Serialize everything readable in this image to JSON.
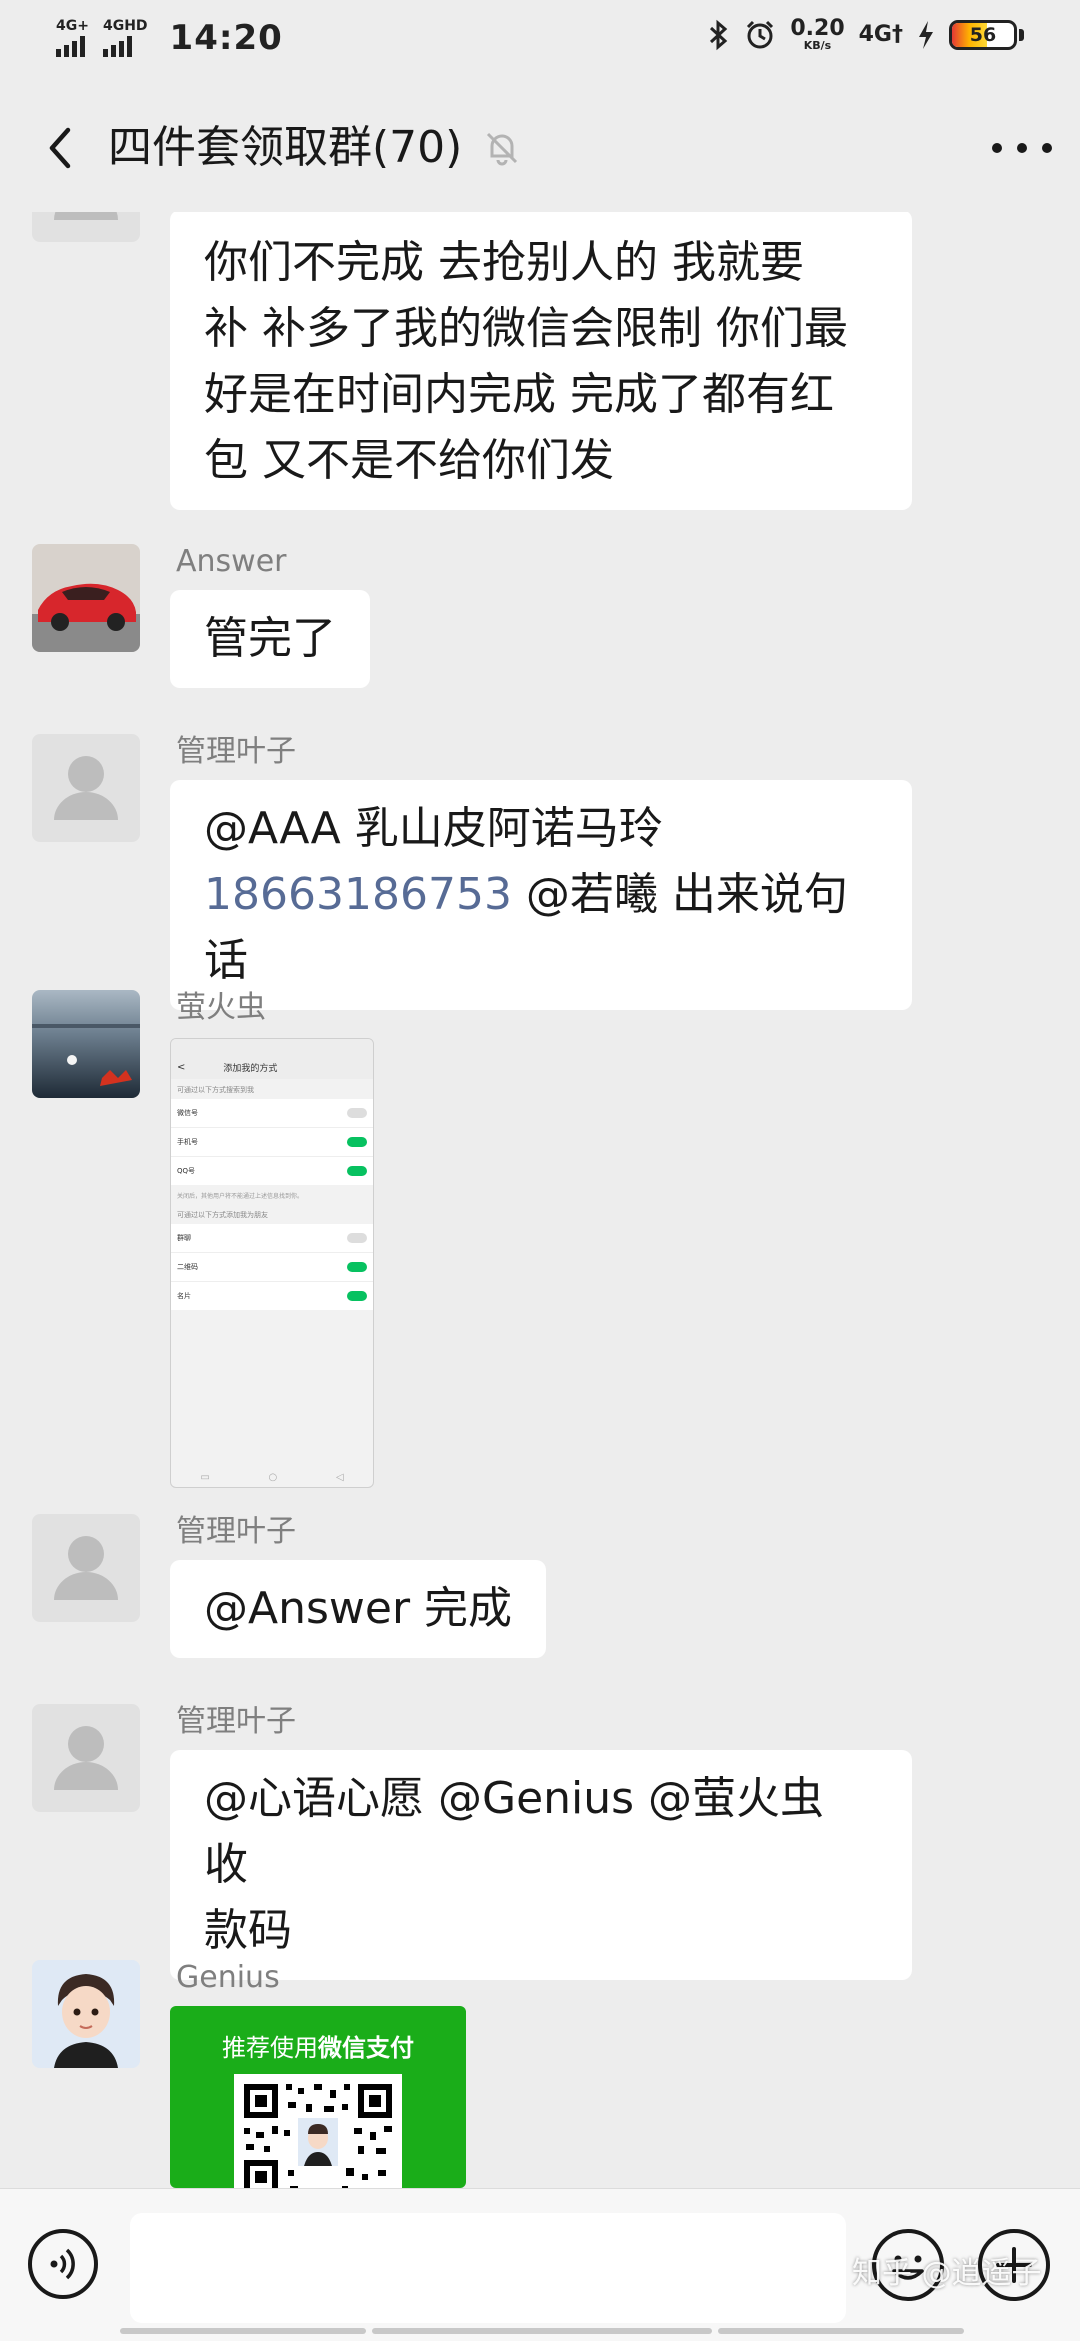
{
  "status_bar": {
    "signal1": "4G+",
    "signal2": "4GHD",
    "time": "14:20",
    "net_speed": "0.20",
    "net_unit": "KB/s",
    "net_type": "4G†",
    "battery": "56",
    "battery_level": 0.56
  },
  "header": {
    "title": "四件套领取群(70)",
    "back_icon": "chevron-left-icon",
    "mute_icon": "bell-off-icon",
    "more_icon": "more-dots-icon"
  },
  "messages": [
    {
      "sender": "",
      "avatar": "default-avatar",
      "lines": [
        "你们不完成  去抢别人的  我就要",
        "补  补多了我的微信会限制  你们最",
        "好是在时间内完成   完成了都有红",
        "包   又不是不给你们发"
      ]
    },
    {
      "sender": "Answer",
      "avatar": "red-car-avatar",
      "lines": [
        "管完了"
      ]
    },
    {
      "sender": "管理叶子",
      "avatar": "default-avatar",
      "lines": [
        "@AAA 乳山皮阿诺马玲"
      ],
      "phone": "18663186753",
      "tail": " @若曦 出来说句话"
    },
    {
      "sender": "萤火虫",
      "avatar": "lake-avatar",
      "image": "settings-screenshot",
      "shot": {
        "title": "添加我的方式",
        "section1": "可通过以下方式搜索到我",
        "rows1": [
          "微信号",
          "手机号",
          "QQ号"
        ],
        "note": "关闭后，其他用户将不能通过上述信息找到你。",
        "section2": "可通过以下方式添加我为朋友",
        "rows2": [
          "群聊",
          "二维码",
          "名片"
        ]
      }
    },
    {
      "sender": "管理叶子",
      "avatar": "default-avatar",
      "lines": [
        "@Answer 完成"
      ]
    },
    {
      "sender": "管理叶子",
      "avatar": "default-avatar",
      "lines": [
        "@心语心愿 @Genius @萤火虫 收",
        "款码"
      ]
    },
    {
      "sender": "Genius",
      "avatar": "cartoon-boy-avatar",
      "image": "payment-qr-code",
      "pay_label_a": "推荐使用",
      "pay_label_b": "微信支付"
    }
  ],
  "input_bar": {
    "voice_icon": "voice-icon",
    "emoji_icon": "emoji-icon",
    "plus_icon": "plus-icon"
  },
  "watermark": "知乎 @逍遥子"
}
